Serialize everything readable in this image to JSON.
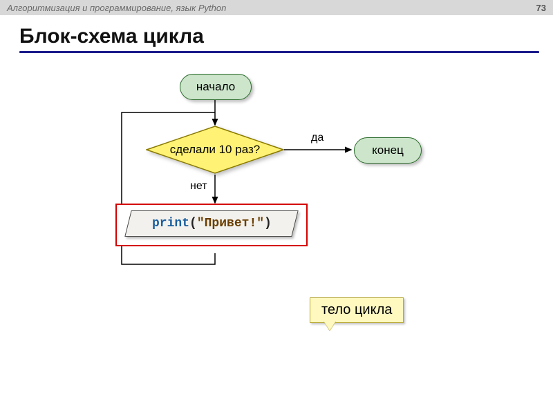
{
  "header": {
    "breadcrumb": "Алгоритмизация и программирование, язык Python",
    "page_number": "73"
  },
  "title": "Блок-схема цикла",
  "flow": {
    "start": "начало",
    "decision": "сделали 10 раз?",
    "yes_label": "да",
    "no_label": "нет",
    "end": "конец",
    "process": {
      "keyword": "print",
      "open": "(",
      "string": "\"Привет!\"",
      "close": ")"
    }
  },
  "callout": "тело цикла",
  "colors": {
    "title_rule": "#1a1a8a",
    "pill_fill": "#cce5cb",
    "pill_border": "#2a6a2a",
    "diamond_fill": "#fff275",
    "diamond_border": "#8a7a00",
    "process_border": "#d40000",
    "callout_fill": "#fff9c0"
  }
}
